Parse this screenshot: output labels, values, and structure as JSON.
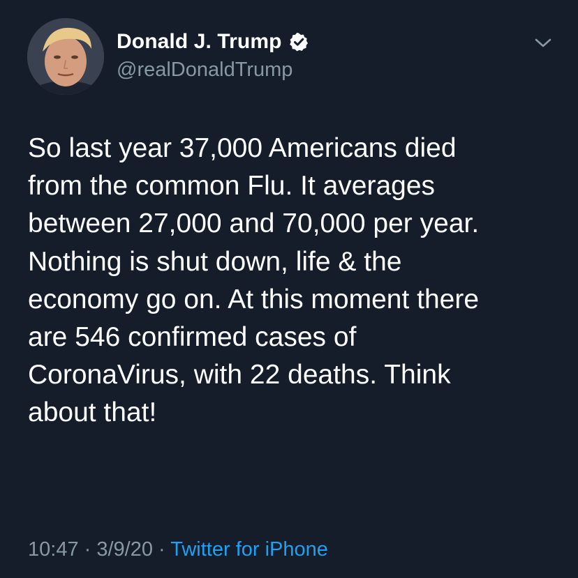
{
  "author": {
    "display_name": "Donald J. Trump",
    "handle": "@realDonaldTrump",
    "verified": true,
    "avatar_icon": "profile-photo"
  },
  "tweet": {
    "text": "So last year 37,000 Americans died\nfrom the common Flu. It averages\nbetween 27,000 and 70,000 per year.\nNothing is shut down, life & the\neconomy go on. At this moment there\nare 546 confirmed cases of\nCoronaVirus, with 22 deaths. Think\nabout that!"
  },
  "meta": {
    "time": "10:47",
    "separator": " · ",
    "date": "3/9/20",
    "source": "Twitter for iPhone"
  },
  "colors": {
    "background": "#151d2a",
    "primary_text": "#ffffff",
    "secondary_text": "#8899a6",
    "link": "#1da1f2"
  },
  "icons": {
    "verified": "verified-badge-icon",
    "menu": "chevron-down-icon"
  }
}
